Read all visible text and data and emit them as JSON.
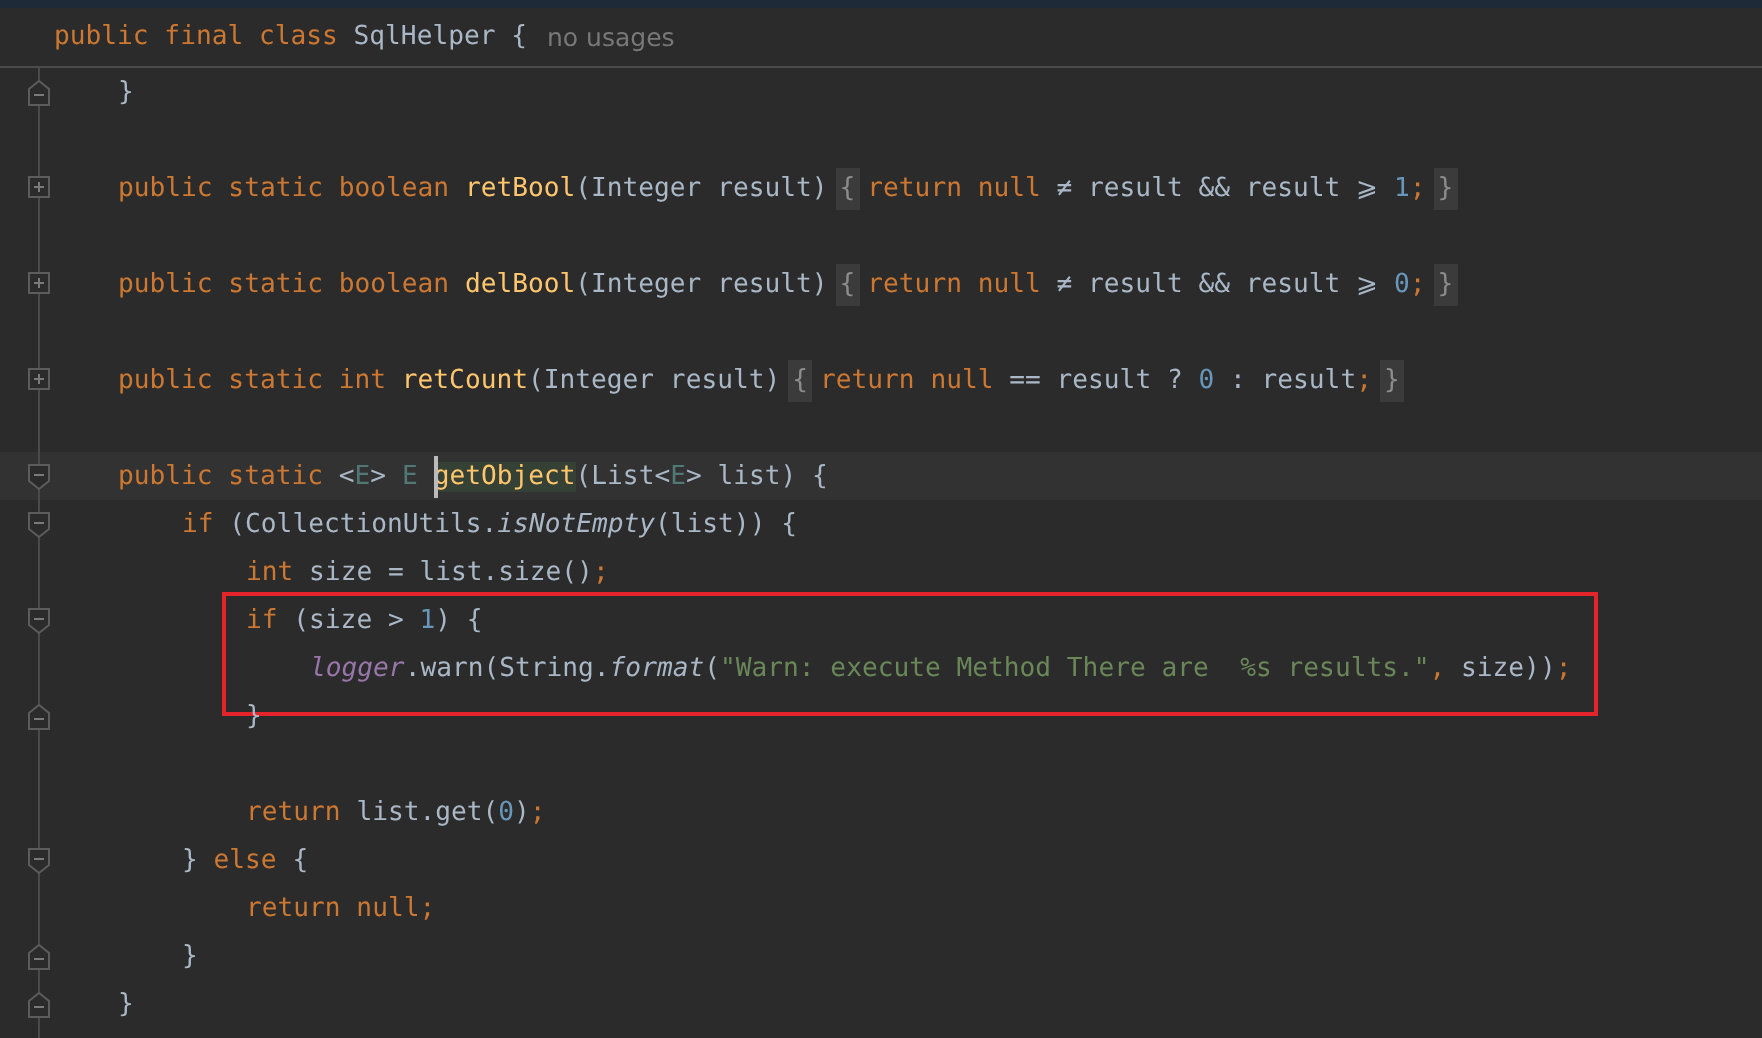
{
  "header": {
    "tokens": [
      {
        "t": "public final class ",
        "kind": "kw"
      },
      {
        "t": "SqlHelper {",
        "kind": "p"
      },
      {
        "t": "no usages",
        "kind": "hint"
      }
    ]
  },
  "lines": [
    {
      "kind": "line",
      "fold": {
        "kind": "end"
      },
      "tokens": [
        {
          "t": "}",
          "kind": "p"
        }
      ]
    },
    {
      "kind": "line"
    },
    {
      "kind": "line",
      "fold": {
        "kind": "plus"
      },
      "tokens": [
        {
          "t": "public static boolean ",
          "kind": "kw"
        },
        {
          "t": "retBool",
          "kind": "fn"
        },
        {
          "t": "(Integer result)",
          "kind": "p"
        },
        {
          "t": "{",
          "kind": "fold"
        },
        {
          "t": "return null ",
          "kind": "kw"
        },
        {
          "t": "≠ result && result ⩾ ",
          "kind": "p"
        },
        {
          "t": "1",
          "kind": "n"
        },
        {
          "t": ";",
          "kind": "kw"
        },
        {
          "t": "}",
          "kind": "fold"
        }
      ]
    },
    {
      "kind": "line"
    },
    {
      "kind": "line",
      "fold": {
        "kind": "plus"
      },
      "tokens": [
        {
          "t": "public static boolean ",
          "kind": "kw"
        },
        {
          "t": "delBool",
          "kind": "fn"
        },
        {
          "t": "(Integer result)",
          "kind": "p"
        },
        {
          "t": "{",
          "kind": "fold"
        },
        {
          "t": "return null ",
          "kind": "kw"
        },
        {
          "t": "≠ result && result ⩾ ",
          "kind": "p"
        },
        {
          "t": "0",
          "kind": "n"
        },
        {
          "t": ";",
          "kind": "kw"
        },
        {
          "t": "}",
          "kind": "fold"
        }
      ]
    },
    {
      "kind": "line"
    },
    {
      "kind": "line",
      "fold": {
        "kind": "plus"
      },
      "tokens": [
        {
          "t": "public static int ",
          "kind": "kw"
        },
        {
          "t": "retCount",
          "kind": "fn"
        },
        {
          "t": "(Integer result)",
          "kind": "p"
        },
        {
          "t": "{",
          "kind": "fold"
        },
        {
          "t": "return null ",
          "kind": "kw"
        },
        {
          "t": "== result ? ",
          "kind": "p"
        },
        {
          "t": "0",
          "kind": "n"
        },
        {
          "t": " : result",
          "kind": "p"
        },
        {
          "t": ";",
          "kind": "kw"
        },
        {
          "t": "}",
          "kind": "fold"
        }
      ]
    },
    {
      "kind": "line"
    },
    {
      "kind": "line",
      "fold": {
        "kind": "start"
      },
      "current": true,
      "tokens": [
        {
          "t": "public static ",
          "kind": "kw"
        },
        {
          "t": "<",
          "kind": "p"
        },
        {
          "t": "E",
          "kind": "tp"
        },
        {
          "t": "> ",
          "kind": "p"
        },
        {
          "t": "E",
          "kind": "tp"
        },
        {
          "t": "getObject",
          "kind": "match",
          "caret": true
        },
        {
          "t": "(List<",
          "kind": "p"
        },
        {
          "t": "E",
          "kind": "tp"
        },
        {
          "t": "> list) {",
          "kind": "p"
        }
      ],
      "children": [
        {
          "kind": "line",
          "fold": {
            "kind": "start"
          },
          "tokens": [
            {
              "t": "if ",
              "kind": "kw"
            },
            {
              "t": "(CollectionUtils.",
              "kind": "p"
            },
            {
              "t": "isNotEmpty",
              "kind": "it"
            },
            {
              "t": "(list)) {",
              "kind": "p"
            }
          ],
          "children": [
            {
              "kind": "line",
              "tokens": [
                {
                  "t": "int ",
                  "kind": "kw"
                },
                {
                  "t": "size = list.size()",
                  "kind": "p"
                },
                {
                  "t": ";",
                  "kind": "kw"
                }
              ]
            },
            {
              "kind": "box",
              "children": [
                {
                  "kind": "line",
                  "fold": {
                    "kind": "start"
                  },
                  "tokens": [
                    {
                      "t": "if ",
                      "kind": "kw"
                    },
                    {
                      "t": "(size > ",
                      "kind": "p"
                    },
                    {
                      "t": "1",
                      "kind": "n"
                    },
                    {
                      "t": ") {",
                      "kind": "p"
                    }
                  ],
                  "children": [
                    {
                      "kind": "line",
                      "tokens": [
                        {
                          "t": "logger",
                          "kind": "fld"
                        },
                        {
                          "t": ".warn(String.",
                          "kind": "p"
                        },
                        {
                          "t": "format",
                          "kind": "it"
                        },
                        {
                          "t": "(",
                          "kind": "p"
                        },
                        {
                          "t": "\"Warn: execute Method There are  %s results.\"",
                          "kind": "s"
                        },
                        {
                          "t": ",",
                          "kind": "kw"
                        },
                        {
                          "t": " size))",
                          "kind": "p"
                        },
                        {
                          "t": ";",
                          "kind": "kw"
                        }
                      ]
                    }
                  ]
                },
                {
                  "kind": "line",
                  "fold": {
                    "kind": "end"
                  },
                  "tokens": [
                    {
                      "t": "}",
                      "kind": "p"
                    }
                  ]
                }
              ]
            },
            {
              "kind": "line"
            },
            {
              "kind": "line",
              "tokens": [
                {
                  "t": "return ",
                  "kind": "kw"
                },
                {
                  "t": "list.get(",
                  "kind": "p"
                },
                {
                  "t": "0",
                  "kind": "n"
                },
                {
                  "t": ")",
                  "kind": "p"
                },
                {
                  "t": ";",
                  "kind": "kw"
                }
              ]
            }
          ]
        },
        {
          "kind": "line",
          "fold": {
            "kind": "start"
          },
          "tokens": [
            {
              "t": "} ",
              "kind": "p"
            },
            {
              "t": "else ",
              "kind": "kw"
            },
            {
              "t": "{",
              "kind": "p"
            }
          ],
          "children": [
            {
              "kind": "line",
              "tokens": [
                {
                  "t": "return null",
                  "kind": "kw"
                },
                {
                  "t": ";",
                  "kind": "kw"
                }
              ]
            }
          ]
        },
        {
          "kind": "line",
          "fold": {
            "kind": "end"
          },
          "tokens": [
            {
              "t": "}",
              "kind": "p"
            }
          ]
        }
      ]
    },
    {
      "kind": "line",
      "fold": {
        "kind": "end"
      },
      "tokens": [
        {
          "t": "}",
          "kind": "p"
        }
      ]
    }
  ]
}
